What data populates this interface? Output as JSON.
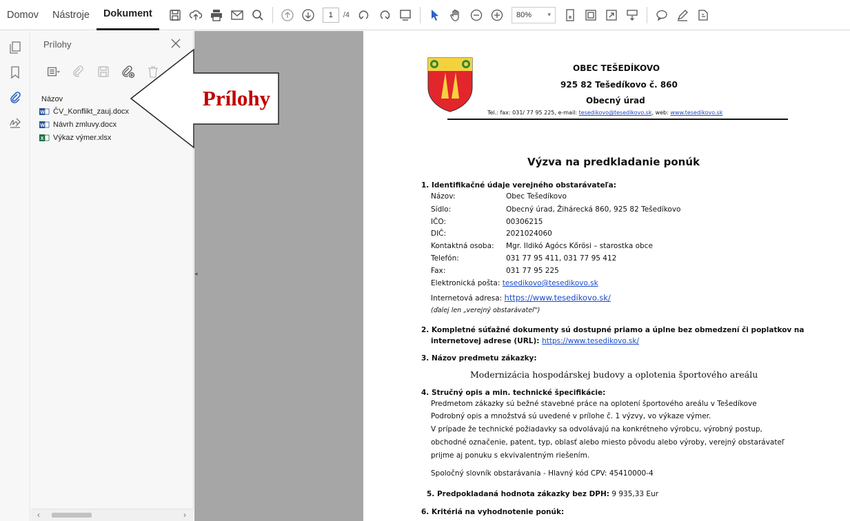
{
  "menu": {
    "home": "Domov",
    "tools": "Nástroje",
    "document": "Dokument"
  },
  "toolbar": {
    "page_current": "1",
    "page_total": "/4",
    "zoom": "80%"
  },
  "rail": {
    "icons": [
      "pages-icon",
      "bookmark-icon",
      "paperclip-icon",
      "signature-icon"
    ]
  },
  "panel": {
    "title": "Prílohy",
    "column_header": "Názov",
    "files": [
      {
        "name": "ČV_Konflikt_zauj.docx",
        "type": "word"
      },
      {
        "name": "Návrh zmluvy.docx",
        "type": "word"
      },
      {
        "name": "Výkaz výmer.xlsx",
        "type": "excel"
      }
    ]
  },
  "callout": {
    "text": "Prílohy",
    "color": "#c00000"
  },
  "document": {
    "header": {
      "org_name": "OBEC TEŠEDÍKOVO",
      "address": "925 82 Tešedíkovo č. 860",
      "office": "Obecný úrad",
      "contact_prefix": "Tel.: fax: 031/ 77 95 225, e-mail: ",
      "email": "tesedikovo@tesedikovo.sk",
      "web_prefix": ", web: ",
      "web": "www.tesedikovo.sk"
    },
    "title": "Výzva na predkladanie ponúk",
    "s1": {
      "heading": "1.  Identifikačné údaje verejného obstarávateľa:",
      "rows": [
        {
          "label": "Názov:",
          "value": "Obec Tešedíkovo"
        },
        {
          "label": "Sídlo:",
          "value": "Obecný úrad, Žihárecká 860, 925 82 Tešedíkovo"
        },
        {
          "label": "IČO:",
          "value": "00306215"
        },
        {
          "label": "DIČ:",
          "value": "2021024060"
        },
        {
          "label": "Kontaktná osoba:",
          "value": "Mgr. Ildikó Agócs Kőrösi – starostka obce"
        },
        {
          "label": "Telefón:",
          "value": "031 77 95 411, 031 77 95 412"
        },
        {
          "label": "Fax:",
          "value": "031 77 95 225"
        }
      ],
      "email_label": "Elektronická pošta:",
      "email": "tesedikovo@tesedikovo.sk",
      "web_label": "Internetová adresa:",
      "web": "https://www.tesedikovo.sk/",
      "note": "(ďalej len „verejný obstarávateľ“)"
    },
    "s2": {
      "line1": "2.  Kompletné súťažné dokumenty sú dostupné priamo a úplne bez obmedzení či poplatkov na",
      "line2": "internetovej adrese (URL): ",
      "url": "https://www.tesedikovo.sk/"
    },
    "s3": {
      "heading": "3.  Názov predmetu zákazky:",
      "subject": "Modernizácia hospodárskej budovy a oplotenia športového areálu"
    },
    "s4": {
      "heading": "4.  Stručný opis a min. technické špecifikácie:",
      "lines": [
        "Predmetom zákazky sú bežné stavebné práce na oplotení športového areálu v Tešedíkove",
        "Podrobný opis a množstvá sú uvedené v prílohe č. 1 výzvy, vo výkaze výmer.",
        "V prípade že technické požiadavky sa odvolávajú na konkrétneho výrobcu, výrobný postup,",
        "obchodné označenie, patent, typ, oblasť alebo miesto pôvodu alebo výroby, verejný obstarávateľ",
        "prijme aj ponuku s ekvivalentným riešením."
      ],
      "cpv": "Spoločný slovník obstarávania - Hlavný kód CPV: 45410000-4"
    },
    "s5": {
      "heading": "5.  Predpokladaná hodnota zákazky bez DPH:",
      "value": " 9 935,33 Eur"
    },
    "s6": {
      "heading": "6.  Kritériá na vyhodnotenie ponúk:"
    }
  }
}
